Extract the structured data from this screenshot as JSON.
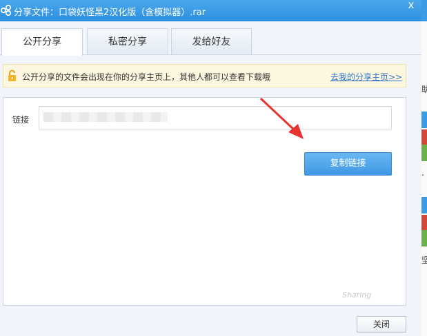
{
  "window": {
    "title": "分享文件：口袋妖怪黑2汉化版（含模拟器）.rar",
    "close_glyph": "x"
  },
  "tabs": [
    {
      "label": "公开分享",
      "active": true
    },
    {
      "label": "私密分享",
      "active": false
    },
    {
      "label": "发给好友",
      "active": false
    }
  ],
  "notice": {
    "text": "公开分享的文件会出现在你的分享主页上，其他人都可以查看下载哦",
    "link": "去我的分享主页>>"
  },
  "share": {
    "link_label": "链接",
    "link_value": "",
    "copy_button": "复制链接"
  },
  "footer": {
    "close_button": "关闭"
  },
  "background_window": {
    "fragments": [
      "助",
      ".",
      "坚"
    ]
  },
  "colors": {
    "titlebar": "#3a9ae6",
    "primary_button": "#4a9fe8",
    "link": "#2f73c7",
    "annotation_arrow": "#e8322e"
  }
}
